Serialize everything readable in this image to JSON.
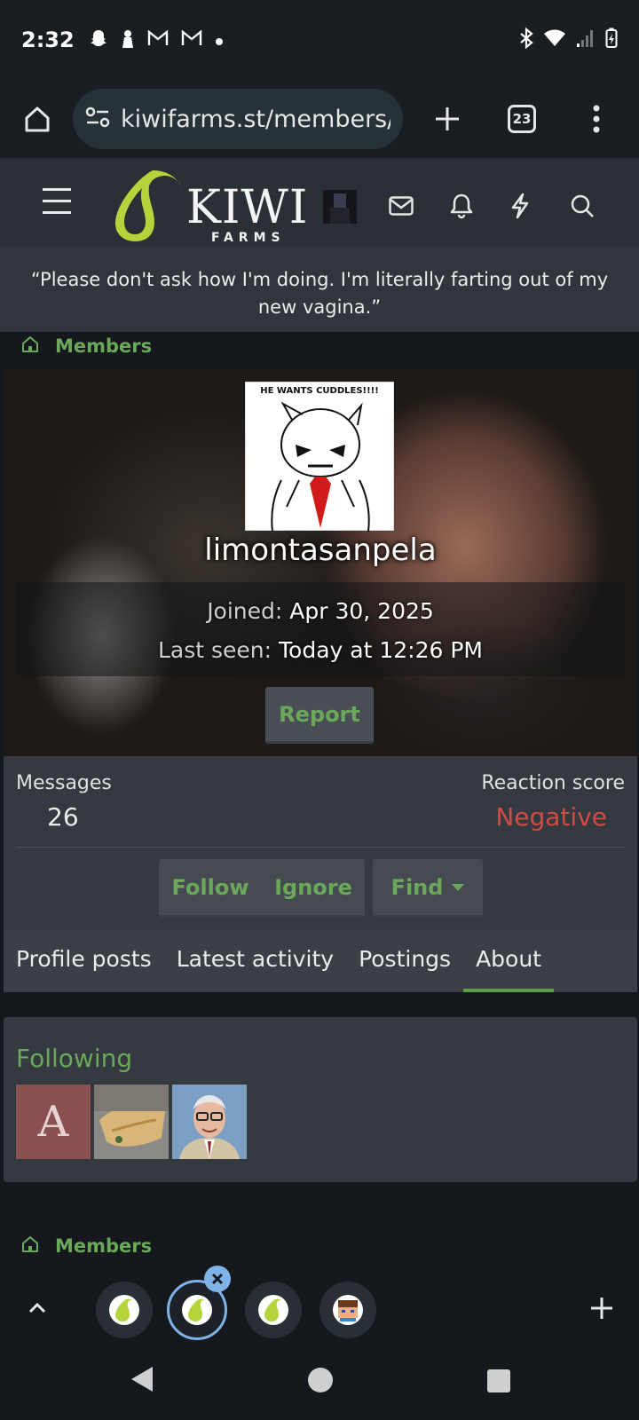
{
  "status_bar": {
    "time": "2:32"
  },
  "browser": {
    "url": "kiwifarms.st/members/lir",
    "tab_count": "23"
  },
  "site": {
    "logo_main": "KIWI",
    "logo_sub": "FARMS",
    "quote": "“Please don't ask how I'm doing. I'm literally farting out of my new vagina.”"
  },
  "breadcrumb": {
    "label": "Members"
  },
  "profile": {
    "avatar_caption": "HE WANTS CUDDLES!!!!",
    "username": "limontasanpela",
    "joined_label": "Joined:",
    "joined_value": "Apr 30, 2025",
    "last_seen_label": "Last seen:",
    "last_seen_value": "Today at 12:26 PM",
    "report_label": "Report"
  },
  "summary": {
    "messages_label": "Messages",
    "messages_value": "26",
    "reaction_label": "Reaction score",
    "reaction_value": "Negative",
    "follow_label": "Follow",
    "ignore_label": "Ignore",
    "find_label": "Find"
  },
  "tabs": [
    "Profile posts",
    "Latest activity",
    "Postings",
    "About"
  ],
  "active_tab": "About",
  "following": {
    "title": "Following",
    "letter_avatar": "A"
  },
  "colors": {
    "accent_green": "#6aa85a",
    "negative_red": "#d14b45",
    "kiwi_lime": "#b5d43b"
  }
}
